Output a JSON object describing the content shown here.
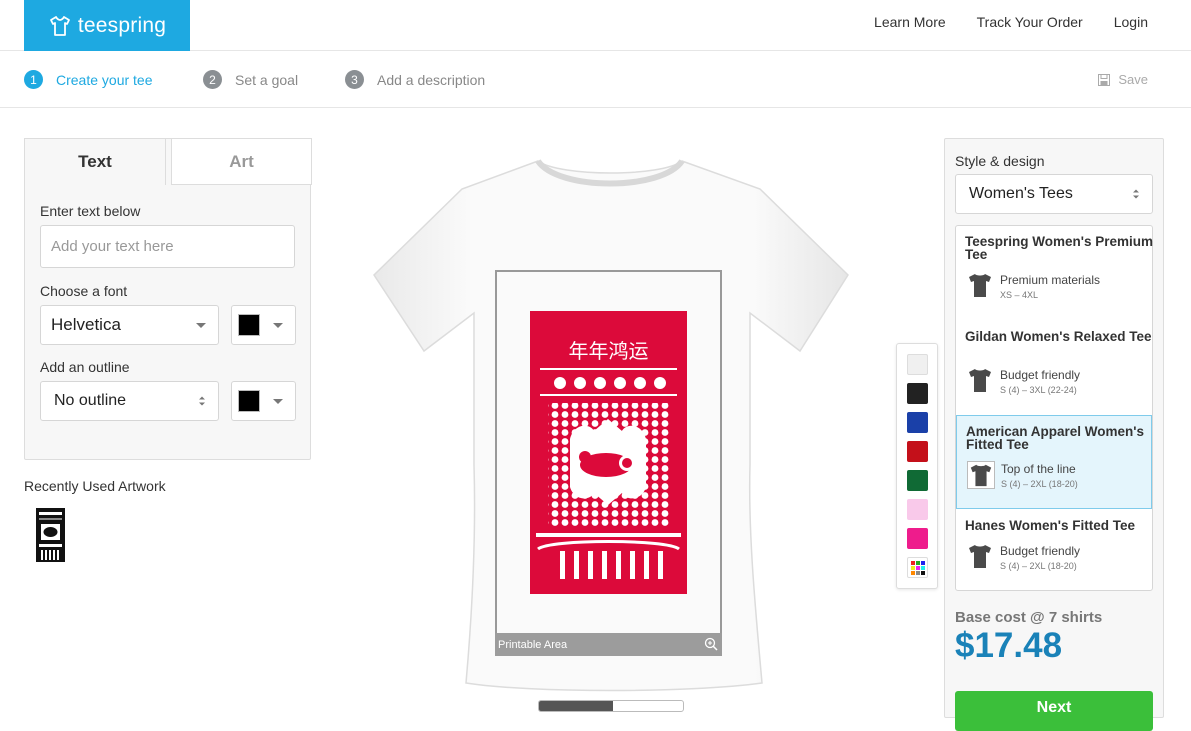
{
  "header": {
    "logo_text": "teespring",
    "nav": [
      "Learn More",
      "Track Your Order",
      "Login"
    ]
  },
  "steps": {
    "items": [
      {
        "num": "1",
        "label": "Create your tee"
      },
      {
        "num": "2",
        "label": "Set a goal"
      },
      {
        "num": "3",
        "label": "Add a description"
      }
    ],
    "save_label": "Save"
  },
  "left_panel": {
    "tabs": [
      "Text",
      "Art"
    ],
    "enter_text_label": "Enter text below",
    "text_placeholder": "Add your text here",
    "font_label": "Choose a font",
    "font_value": "Helvetica",
    "font_color": "#000000",
    "outline_label": "Add an outline",
    "outline_value": "No outline",
    "outline_color": "#000000"
  },
  "recent": {
    "title": "Recently Used Artwork"
  },
  "canvas": {
    "printable_label": "Printable Area",
    "design_text": "年年鸿运"
  },
  "colors": {
    "swatches": [
      "#f0f0f0",
      "#222222",
      "#1a40a8",
      "#c4101a",
      "#106a35",
      "#f9c9ea",
      "#ee1c8c"
    ],
    "accent": "#1ea9e1",
    "design_red": "#dc0a3a"
  },
  "right_panel": {
    "title": "Style & design",
    "style_value": "Women's Tees",
    "products": [
      {
        "name": "Teespring Women's Premium Tee",
        "desc": "Premium materials",
        "sizes": "XS – 4XL"
      },
      {
        "name": "Gildan Women's Relaxed Tee",
        "desc": "Budget friendly",
        "sizes": "S (4) – 3XL (22-24)"
      },
      {
        "name": "American Apparel Women's Fitted Tee",
        "desc": "Top of the line",
        "sizes": "S (4) – 2XL (18-20)"
      },
      {
        "name": "Hanes Women's Fitted Tee",
        "desc": "Budget friendly",
        "sizes": "S (4) – 2XL (18-20)"
      }
    ],
    "selected_product": "American Apparel Women's Fitted Tee",
    "base_cost_label": "Base cost @ 7 shirts",
    "price": "$17.48",
    "next_label": "Next"
  }
}
